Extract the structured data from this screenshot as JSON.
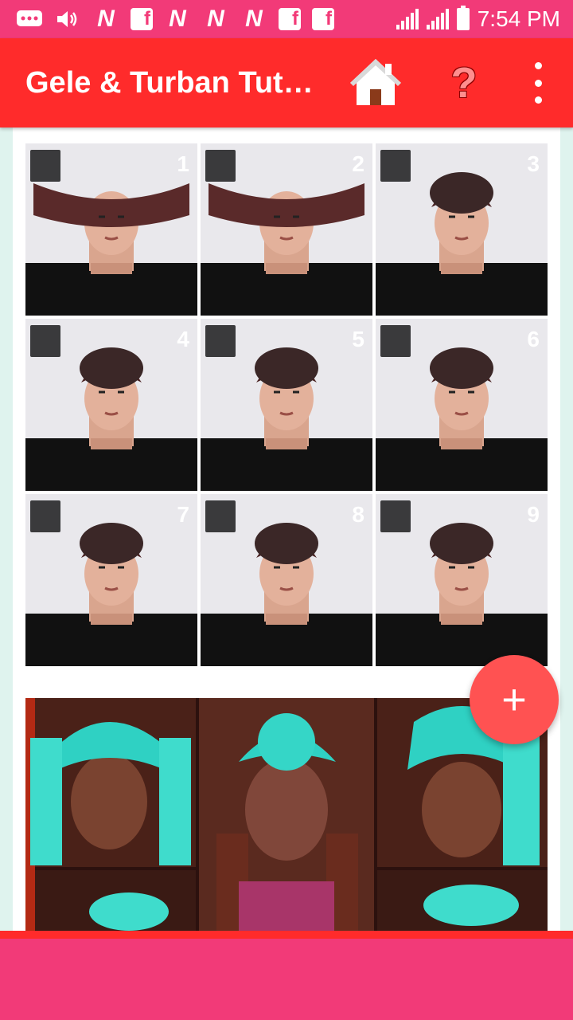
{
  "status_bar": {
    "time": "7:54 PM",
    "notification_icons": [
      "message-icon",
      "volume-icon",
      "n-notification-icon",
      "facebook-icon",
      "n-notification-icon",
      "n-notification-icon",
      "n-notification-icon",
      "facebook-icon",
      "facebook-icon"
    ],
    "n_glyph": "N",
    "fb_glyph": "f"
  },
  "app_bar": {
    "title": "Gele & Turban Tut…",
    "help_glyph": "?"
  },
  "gallery": {
    "tutorial_steps": [
      "1",
      "2",
      "3",
      "4",
      "5",
      "6",
      "7",
      "8",
      "9"
    ]
  },
  "fab": {
    "label": "+"
  },
  "colors": {
    "status_bar": "#f23a78",
    "app_bar": "#ff2b2b",
    "fab": "#ff5252",
    "background": "#dff3ee"
  }
}
